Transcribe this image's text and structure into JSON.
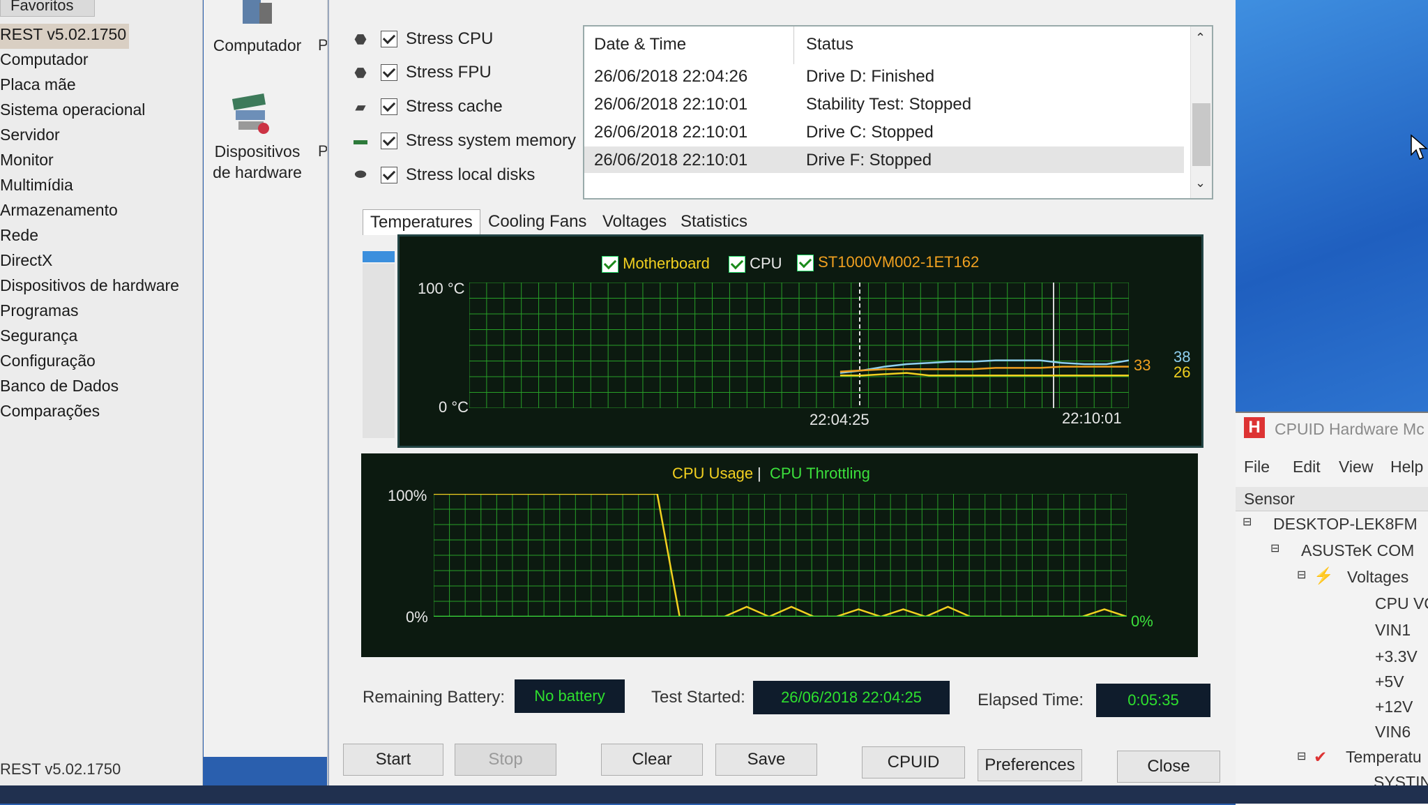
{
  "left_nav": {
    "favorites_tab": "Favoritos",
    "items": [
      "REST v5.02.1750",
      "Computador",
      "Placa mãe",
      "Sistema operacional",
      "Servidor",
      "Monitor",
      "Multimídia",
      "Armazenamento",
      "Rede",
      "DirectX",
      "Dispositivos de hardware",
      "Programas",
      "Segurança",
      "Configuração",
      "Banco de Dados",
      "Comparações"
    ],
    "status": "REST v5.02.1750"
  },
  "icons": {
    "computer_label": "Computador",
    "devices_label_1": "Dispositivos",
    "devices_label_2": "de hardware",
    "letter_p": "P"
  },
  "stress": {
    "items": [
      "Stress CPU",
      "Stress FPU",
      "Stress cache",
      "Stress system memory",
      "Stress local disks"
    ]
  },
  "log": {
    "headers": {
      "date": "Date & Time",
      "status": "Status"
    },
    "rows": [
      {
        "date": "26/06/2018 22:04:26",
        "status": "Drive D: Finished"
      },
      {
        "date": "26/06/2018 22:10:01",
        "status": "Stability Test: Stopped"
      },
      {
        "date": "26/06/2018 22:10:01",
        "status": "Drive C: Stopped"
      },
      {
        "date": "26/06/2018 22:10:01",
        "status": "Drive F: Stopped"
      }
    ]
  },
  "tabs": [
    "Temperatures",
    "Cooling Fans",
    "Voltages",
    "Statistics"
  ],
  "temp_graph": {
    "legend": [
      "Motherboard",
      "CPU",
      "ST1000VM002-1ET162"
    ],
    "legend_colors": [
      "#f2d020",
      "#e8e8e8",
      "#f0a020"
    ],
    "y_top": "100 °C",
    "y_bottom": "0 °C",
    "x_left": "22:04:25",
    "x_right": "22:10:01",
    "val_38": "38",
    "val_33": "33",
    "val_26": "26"
  },
  "cpu_graph": {
    "title_usage": "CPU Usage",
    "sep": "|",
    "title_throttle": "CPU Throttling",
    "y_top": "100%",
    "y_bottom": "0%",
    "current": "0%"
  },
  "info": {
    "battery_label": "Remaining Battery:",
    "battery_value": "No battery",
    "started_label": "Test Started:",
    "started_value": "26/06/2018 22:04:25",
    "elapsed_label": "Elapsed Time:",
    "elapsed_value": "0:05:35"
  },
  "buttons": {
    "start": "Start",
    "stop": "Stop",
    "clear": "Clear",
    "save": "Save",
    "cpuid": "CPUID",
    "preferences": "Preferences",
    "close": "Close"
  },
  "hwmonitor": {
    "title": "CPUID Hardware Mc",
    "menu": [
      "File",
      "Edit",
      "View",
      "Help"
    ],
    "sensor_header": "Sensor",
    "tree": [
      "DESKTOP-LEK8FM",
      "ASUSTeK COM",
      "Voltages",
      "CPU VC",
      "VIN1",
      "+3.3V",
      "+5V",
      "+12V",
      "VIN6",
      "Temperatu",
      "SYSTIN"
    ]
  },
  "chart_data": [
    {
      "type": "line",
      "title": "",
      "legend": [
        "Motherboard",
        "CPU",
        "ST1000VM002-1ET162"
      ],
      "ylim": [
        0,
        100
      ],
      "x_ticks": [
        "22:04:25",
        "22:10:01"
      ],
      "series": [
        {
          "name": "CPU",
          "values": [
            null,
            28,
            30,
            33,
            35,
            36,
            37,
            37,
            38,
            38,
            38,
            36,
            35,
            35,
            38
          ]
        },
        {
          "name": "Motherboard",
          "values": [
            null,
            26,
            26,
            27,
            28,
            26,
            26,
            26,
            26,
            26,
            26,
            26,
            26,
            26,
            26
          ]
        },
        {
          "name": "ST1000VM002-1ET162",
          "values": [
            null,
            29,
            30,
            31,
            31,
            31,
            31,
            31,
            32,
            32,
            32,
            33,
            33,
            33,
            33
          ]
        }
      ]
    },
    {
      "type": "line",
      "title": "CPU Usage | CPU Throttling",
      "ylim": [
        0,
        100
      ],
      "series": [
        {
          "name": "CPU Usage",
          "values": [
            100,
            100,
            100,
            100,
            100,
            100,
            100,
            100,
            100,
            100,
            100,
            0,
            0,
            0,
            8,
            0,
            8,
            0,
            0,
            6,
            0,
            6,
            0,
            8,
            0,
            0,
            0,
            0,
            0,
            0,
            6,
            0
          ]
        },
        {
          "name": "CPU Throttling",
          "values": [
            0,
            0,
            0,
            0,
            0,
            0,
            0,
            0,
            0,
            0,
            0,
            0,
            0,
            0,
            0,
            0,
            0,
            0,
            0,
            0,
            0,
            0,
            0,
            0,
            0,
            0,
            0,
            0,
            0,
            0,
            0,
            0
          ]
        }
      ]
    }
  ]
}
